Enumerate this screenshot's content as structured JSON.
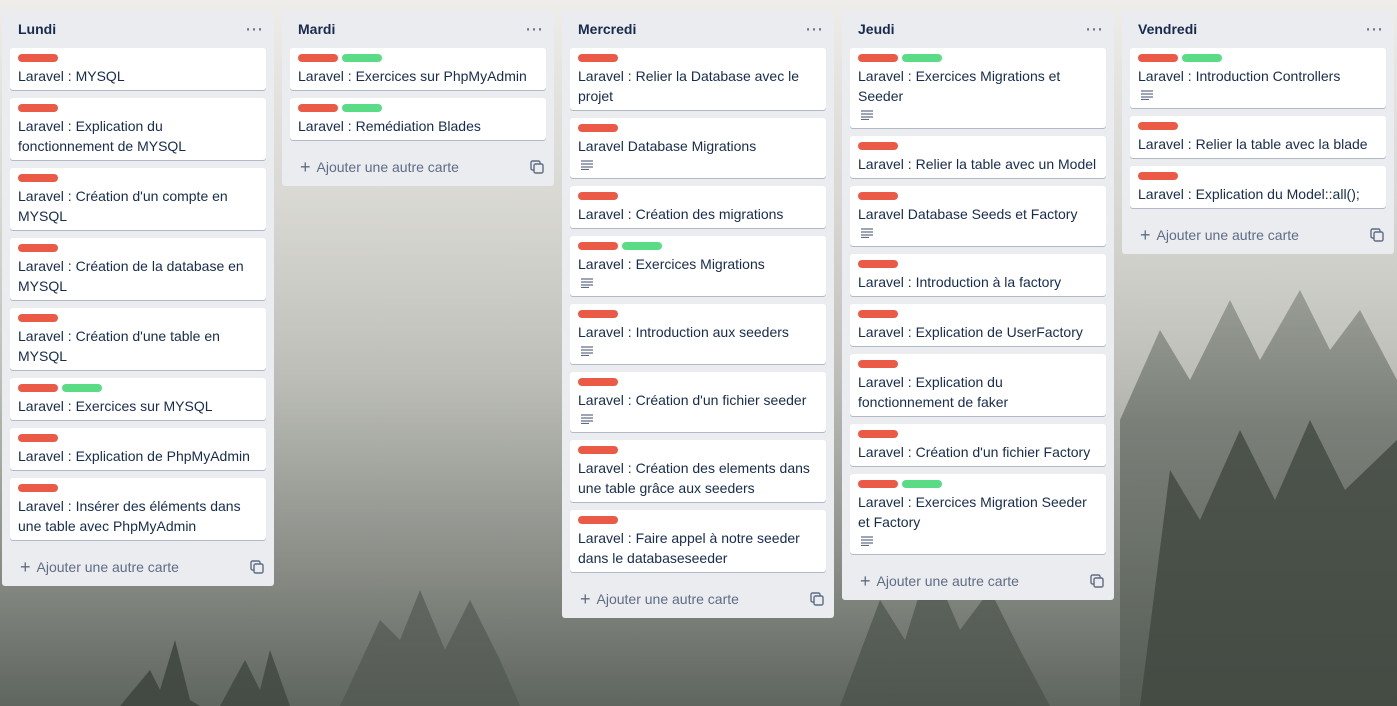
{
  "board": {
    "label_colors": {
      "red": "#eb5a46",
      "green": "#5adb85"
    },
    "add_card_label": "Ajouter une autre carte",
    "lists": [
      {
        "title": "Lundi",
        "cards": [
          {
            "labels": [
              "red"
            ],
            "title": "Laravel : MYSQL",
            "has_description": false
          },
          {
            "labels": [
              "red"
            ],
            "title": "Laravel : Explication du fonctionnement de MYSQL",
            "has_description": false
          },
          {
            "labels": [
              "red"
            ],
            "title": "Laravel : Création d'un compte en MYSQL",
            "has_description": false
          },
          {
            "labels": [
              "red"
            ],
            "title": "Laravel : Création de la database en MYSQL",
            "has_description": false
          },
          {
            "labels": [
              "red"
            ],
            "title": "Laravel : Création d'une table en MYSQL",
            "has_description": false
          },
          {
            "labels": [
              "red",
              "green"
            ],
            "title": "Laravel : Exercices sur MYSQL",
            "has_description": false
          },
          {
            "labels": [
              "red"
            ],
            "title": "Laravel : Explication de PhpMyAdmin",
            "has_description": false
          },
          {
            "labels": [
              "red"
            ],
            "title": "Laravel : Insérer des éléments dans une table avec PhpMyAdmin",
            "has_description": false
          }
        ]
      },
      {
        "title": "Mardi",
        "cards": [
          {
            "labels": [
              "red",
              "green"
            ],
            "title": "Laravel : Exercices sur PhpMyAdmin",
            "has_description": false
          },
          {
            "labels": [
              "red",
              "green"
            ],
            "title": "Laravel : Remédiation Blades",
            "has_description": false
          }
        ]
      },
      {
        "title": "Mercredi",
        "cards": [
          {
            "labels": [
              "red"
            ],
            "title": "Laravel : Relier la Database avec le projet",
            "has_description": false
          },
          {
            "labels": [
              "red"
            ],
            "title": "Laravel Database Migrations",
            "has_description": true
          },
          {
            "labels": [
              "red"
            ],
            "title": "Laravel : Création des migrations",
            "has_description": false
          },
          {
            "labels": [
              "red",
              "green"
            ],
            "title": "Laravel : Exercices Migrations",
            "has_description": true
          },
          {
            "labels": [
              "red"
            ],
            "title": "Laravel : Introduction aux seeders",
            "has_description": true
          },
          {
            "labels": [
              "red"
            ],
            "title": "Laravel : Création d'un fichier seeder",
            "has_description": true
          },
          {
            "labels": [
              "red"
            ],
            "title": "Laravel : Création des elements dans une table grâce aux seeders",
            "has_description": false
          },
          {
            "labels": [
              "red"
            ],
            "title": "Laravel : Faire appel à notre seeder dans le databaseseeder",
            "has_description": false
          }
        ]
      },
      {
        "title": "Jeudi",
        "cards": [
          {
            "labels": [
              "red",
              "green"
            ],
            "title": "Laravel : Exercices Migrations et Seeder",
            "has_description": true
          },
          {
            "labels": [
              "red"
            ],
            "title": "Laravel : Relier la table avec un Model",
            "has_description": false
          },
          {
            "labels": [
              "red"
            ],
            "title": "Laravel Database Seeds et Factory",
            "has_description": true
          },
          {
            "labels": [
              "red"
            ],
            "title": "Laravel : Introduction à la factory",
            "has_description": false
          },
          {
            "labels": [
              "red"
            ],
            "title": "Laravel : Explication de UserFactory",
            "has_description": false
          },
          {
            "labels": [
              "red"
            ],
            "title": "Laravel : Explication du fonctionnement de faker",
            "has_description": false
          },
          {
            "labels": [
              "red"
            ],
            "title": "Laravel : Création d'un fichier Factory",
            "has_description": false
          },
          {
            "labels": [
              "red",
              "green"
            ],
            "title": "Laravel : Exercices Migration Seeder et Factory",
            "has_description": true
          }
        ]
      },
      {
        "title": "Vendredi",
        "cards": [
          {
            "labels": [
              "red",
              "green"
            ],
            "title": "Laravel : Introduction Controllers",
            "has_description": true
          },
          {
            "labels": [
              "red"
            ],
            "title": "Laravel : Relier la table avec la blade",
            "has_description": false
          },
          {
            "labels": [
              "red"
            ],
            "title": "Laravel : Explication du Model::all();",
            "has_description": false
          }
        ]
      }
    ]
  }
}
